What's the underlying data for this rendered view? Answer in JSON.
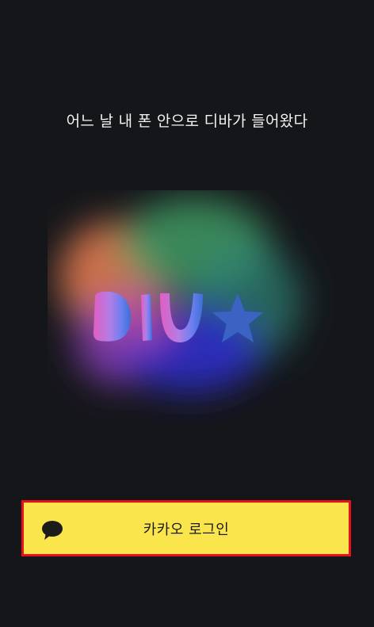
{
  "tagline": "어느 날 내 폰 안으로 디바가 들어왔다",
  "logo": {
    "text": "DIVA",
    "icon": "star-icon"
  },
  "login": {
    "label": "카카오 로그인",
    "icon": "kakao-speech-bubble-icon"
  },
  "colors": {
    "background": "#15161a",
    "kakao_yellow": "#fbe54d",
    "highlight_border": "#e8101c"
  }
}
